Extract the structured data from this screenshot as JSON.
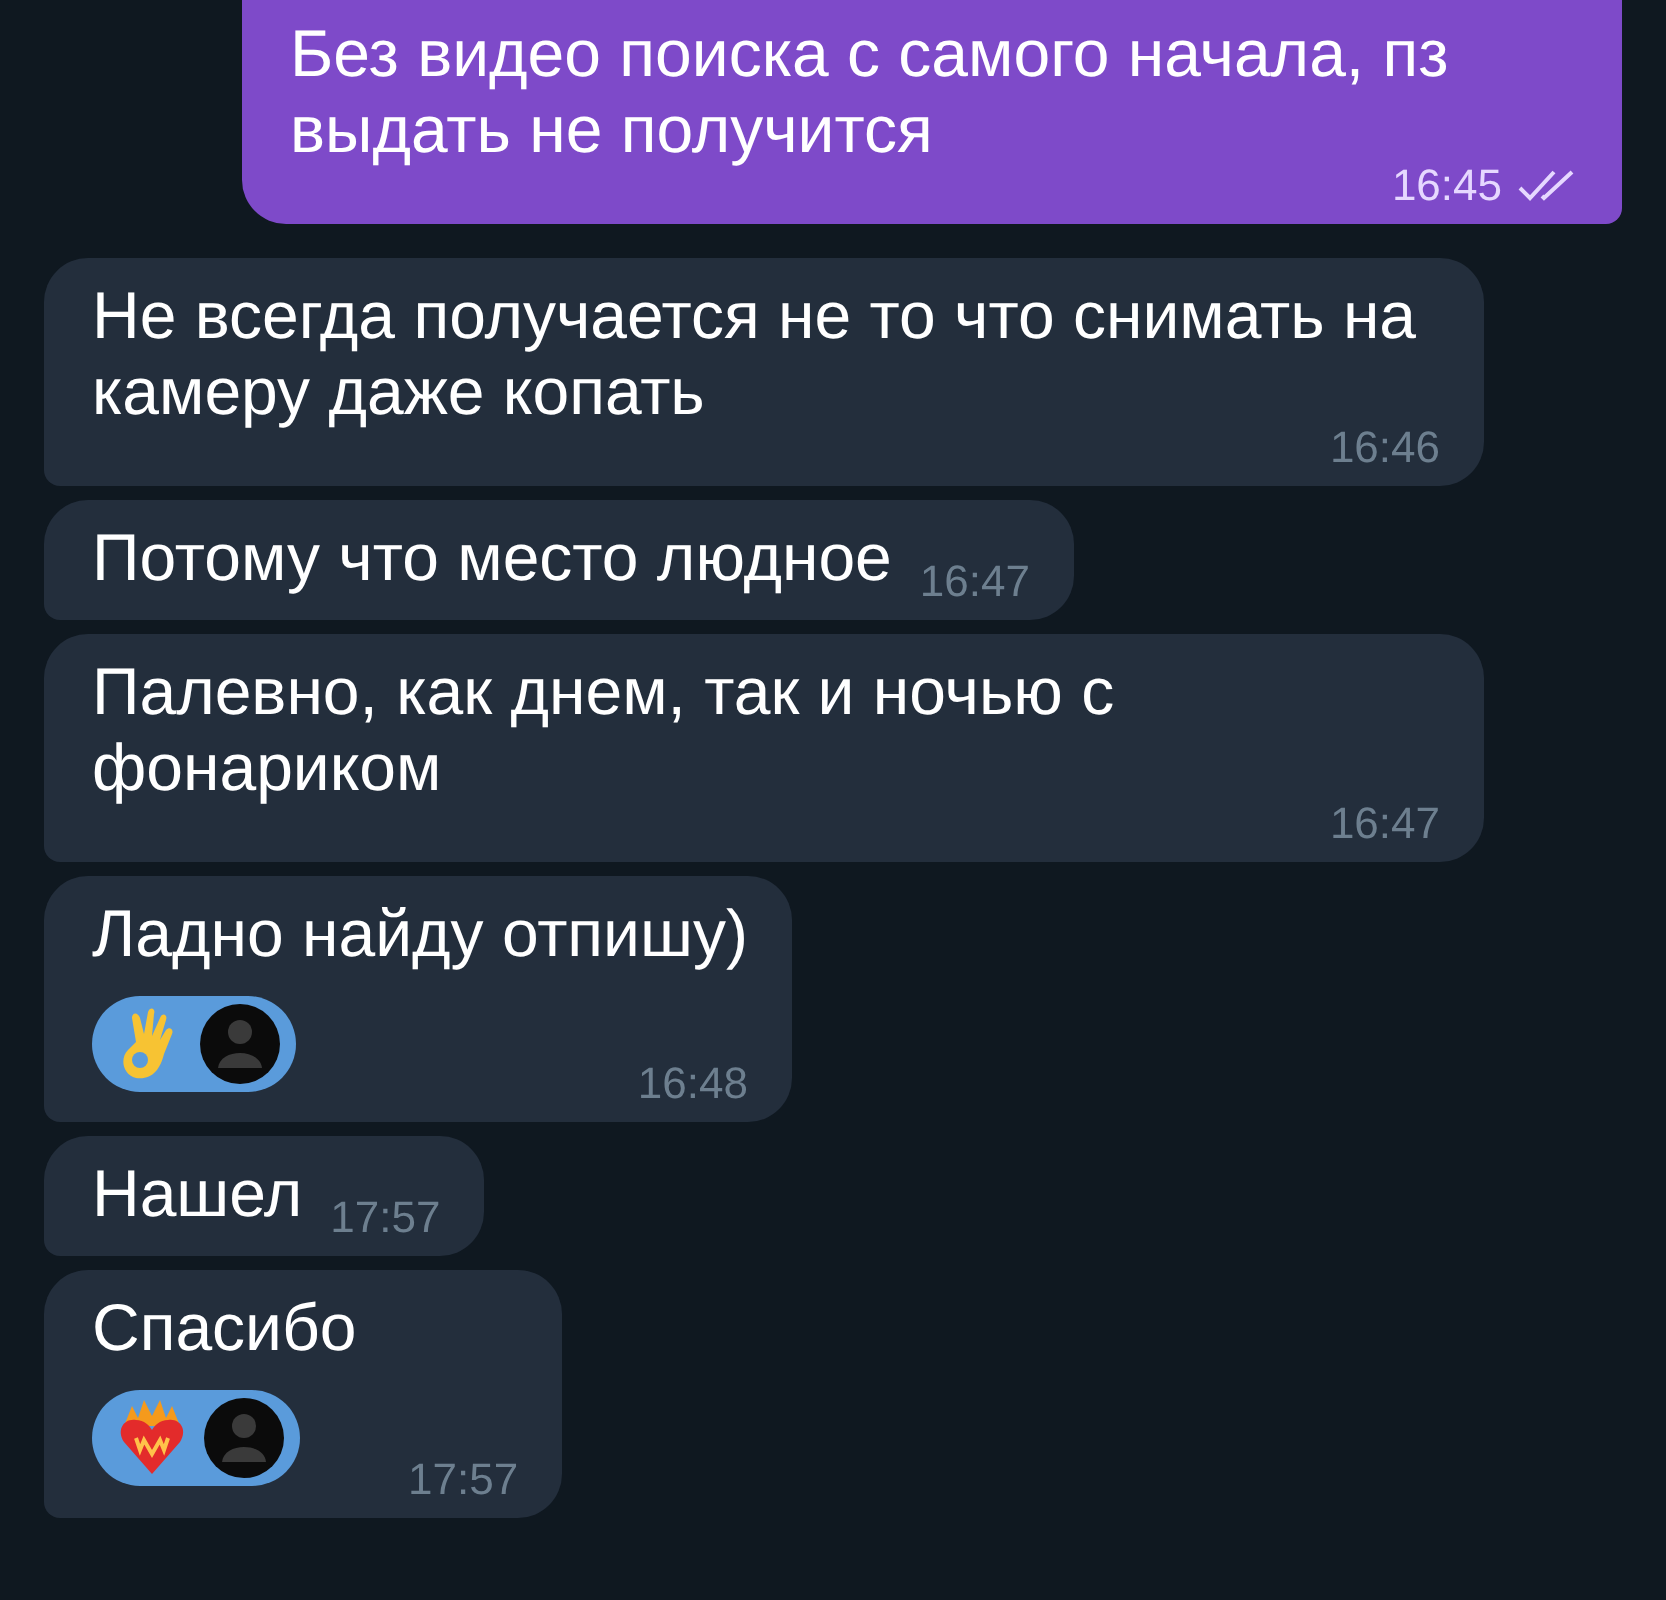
{
  "messages": [
    {
      "kind": "outgoing",
      "text": "Без видео поиска с самого начала, пз выдать не получится",
      "time": "16:45",
      "read": true
    },
    {
      "kind": "incoming",
      "text": "Не всегда получается не то что снимать на камеру даже копать",
      "time": "16:46"
    },
    {
      "kind": "incoming",
      "text": "Потому что место людное",
      "time": "16:47"
    },
    {
      "kind": "incoming",
      "text": "Палевно, как днем, так и ночью с фонариком",
      "time": "16:47"
    },
    {
      "kind": "incoming",
      "text": "Ладно найду отпишу)",
      "time": "16:48",
      "reaction": {
        "kind": "ok_hand"
      }
    },
    {
      "kind": "incoming",
      "text": "Нашел",
      "time": "17:57"
    },
    {
      "kind": "incoming",
      "text": "Спасибо",
      "time": "17:57",
      "reaction": {
        "kind": "fire_heart"
      }
    }
  ]
}
